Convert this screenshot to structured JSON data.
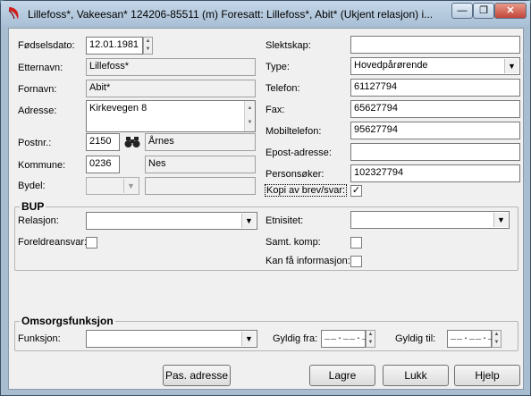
{
  "window": {
    "title": "Lillefoss*, Vakeesan*  124206-85511 (m)  Foresatt: Lillefoss*, Abit* (Ukjent relasjon) i...",
    "minimize_label": "—",
    "maximize_label": "❐",
    "close_label": "✕"
  },
  "left": {
    "fodselsdato_label": "Fødselsdato:",
    "fodselsdato_value": "12.01.1981",
    "etternavn_label": "Etternavn:",
    "etternavn_value": "Lillefoss*",
    "fornavn_label": "Fornavn:",
    "fornavn_value": "Abit*",
    "adresse_label": "Adresse:",
    "adresse_value": "Kirkevegen 8",
    "postnr_label": "Postnr.:",
    "postnr_value": "2150",
    "poststed_value": "Årnes",
    "kommune_label": "Kommune:",
    "kommune_value": "0236",
    "kommune_name": "Nes",
    "bydel_label": "Bydel:"
  },
  "right": {
    "slektskap_label": "Slektskap:",
    "slektskap_value": "",
    "type_label": "Type:",
    "type_value": "Hovedpårørende",
    "telefon_label": "Telefon:",
    "telefon_value": "61127794",
    "fax_label": "Fax:",
    "fax_value": "65627794",
    "mobil_label": "Mobiltelefon:",
    "mobil_value": "95627794",
    "epost_label": "Epost-adresse:",
    "epost_value": "",
    "personsoker_label": "Personsøker:",
    "personsoker_value": "102327794",
    "kopi_label": "Kopi av brev/svar:",
    "kopi_checked": true
  },
  "bup": {
    "title": "BUP",
    "relasjon_label": "Relasjon:",
    "foreldreansvar_label": "Foreldreansvar:",
    "etnisitet_label": "Etnisitet:",
    "samt_komp_label": "Samt. komp:",
    "kan_fa_info_label": "Kan få informasjon:"
  },
  "omsorg": {
    "title": "Omsorgsfunksjon",
    "funksjon_label": "Funksjon:",
    "gyldig_fra_label": "Gyldig fra:",
    "gyldig_fra_value": "__.__.__",
    "gyldig_til_label": "Gyldig til:",
    "gyldig_til_value": "__.__.__"
  },
  "buttons": {
    "pas_adresse": "Pas. adresse",
    "lagre": "Lagre",
    "lukk": "Lukk",
    "hjelp": "Hjelp"
  },
  "icons": {
    "app": "app-logo-icon",
    "search": "binoculars-icon",
    "check": "✓"
  },
  "colors": {
    "titlebar": "#aac0d6",
    "client": "#f0f0f0",
    "close_button": "#c2453a"
  }
}
